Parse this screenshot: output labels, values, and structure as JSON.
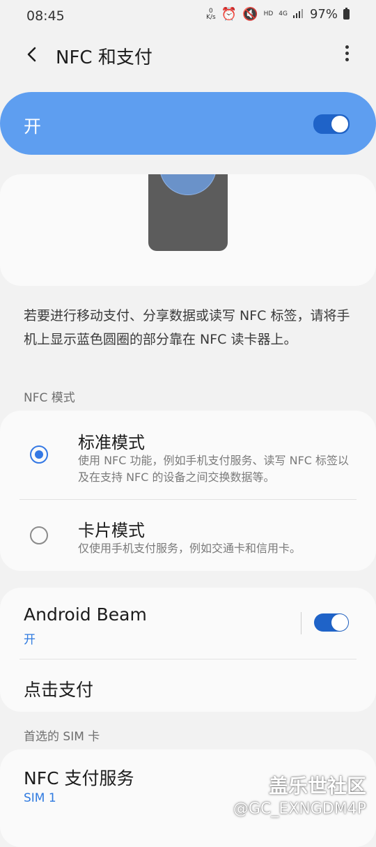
{
  "status_bar": {
    "time": "08:45",
    "speed_value": "0",
    "speed_unit": "K/s",
    "network": "4G",
    "volte": "HD",
    "battery": "97%"
  },
  "app_bar": {
    "title": "NFC 和支付"
  },
  "master_switch": {
    "label": "开",
    "state": "on"
  },
  "description": "若要进行移动支付、分享数据或读写 NFC 标签，请将手机上显示蓝色圆圈的部分靠在 NFC 读卡器上。",
  "nfc_mode": {
    "header": "NFC 模式",
    "options": [
      {
        "title": "标准模式",
        "description": "使用 NFC 功能，例如手机支付服务、读写 NFC 标签以及在支持 NFC 的设备之间交换数据等。",
        "selected": true
      },
      {
        "title": "卡片模式",
        "description": "仅使用手机支付服务，例如交通卡和信用卡。",
        "selected": false
      }
    ]
  },
  "beam": {
    "title": "Android Beam",
    "status": "开",
    "state": "on"
  },
  "tap_pay": {
    "title": "点击支付"
  },
  "sim_section": {
    "header": "首选的 SIM 卡",
    "item_title": "NFC 支付服务",
    "item_value": "SIM 1"
  },
  "watermark": {
    "site": "盖乐世社区",
    "user": "@GC_EXNGDM4P"
  },
  "colors": {
    "accent": "#5e9ef0",
    "toggle_on": "#1f63c8",
    "radio_on": "#3478e4",
    "link_blue": "#2f7ae0"
  }
}
